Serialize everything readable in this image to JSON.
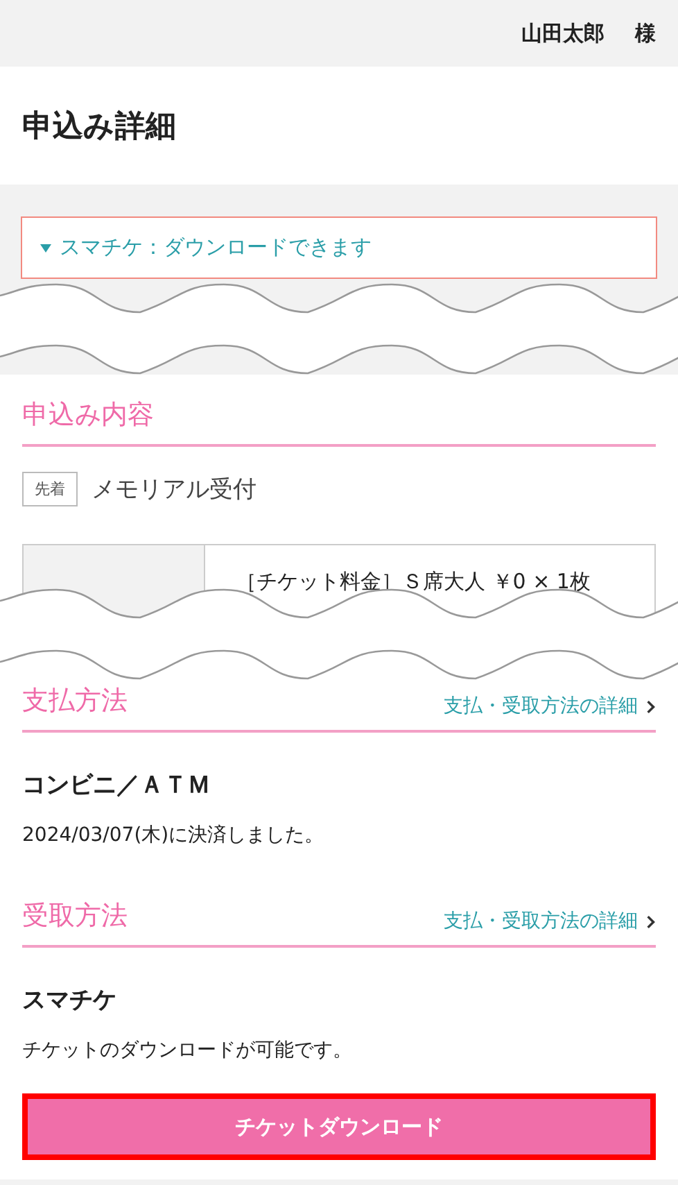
{
  "header": {
    "user_name": "山田太郎",
    "honorific": "様"
  },
  "page_title": "申込み詳細",
  "notice": {
    "text": "スマチケ：ダウンロードできます"
  },
  "sections": [
    {
      "kind": "application",
      "title": "申込み内容",
      "tag": "先着",
      "name": "メモリアル受付",
      "price_text": "［チケット料金］Ｓ席大人 ￥0 × 1枚"
    },
    {
      "kind": "method",
      "title": "支払方法",
      "link": "支払・受取方法の詳細",
      "value": "コンビニ／ＡＴＭ",
      "note": "2024/03/07(木)に決済しました。"
    },
    {
      "kind": "method",
      "title": "受取方法",
      "link": "支払・受取方法の詳細",
      "value": "スマチケ",
      "note": "チケットのダウンロードが可能です。",
      "button": "チケットダウンロード"
    }
  ]
}
